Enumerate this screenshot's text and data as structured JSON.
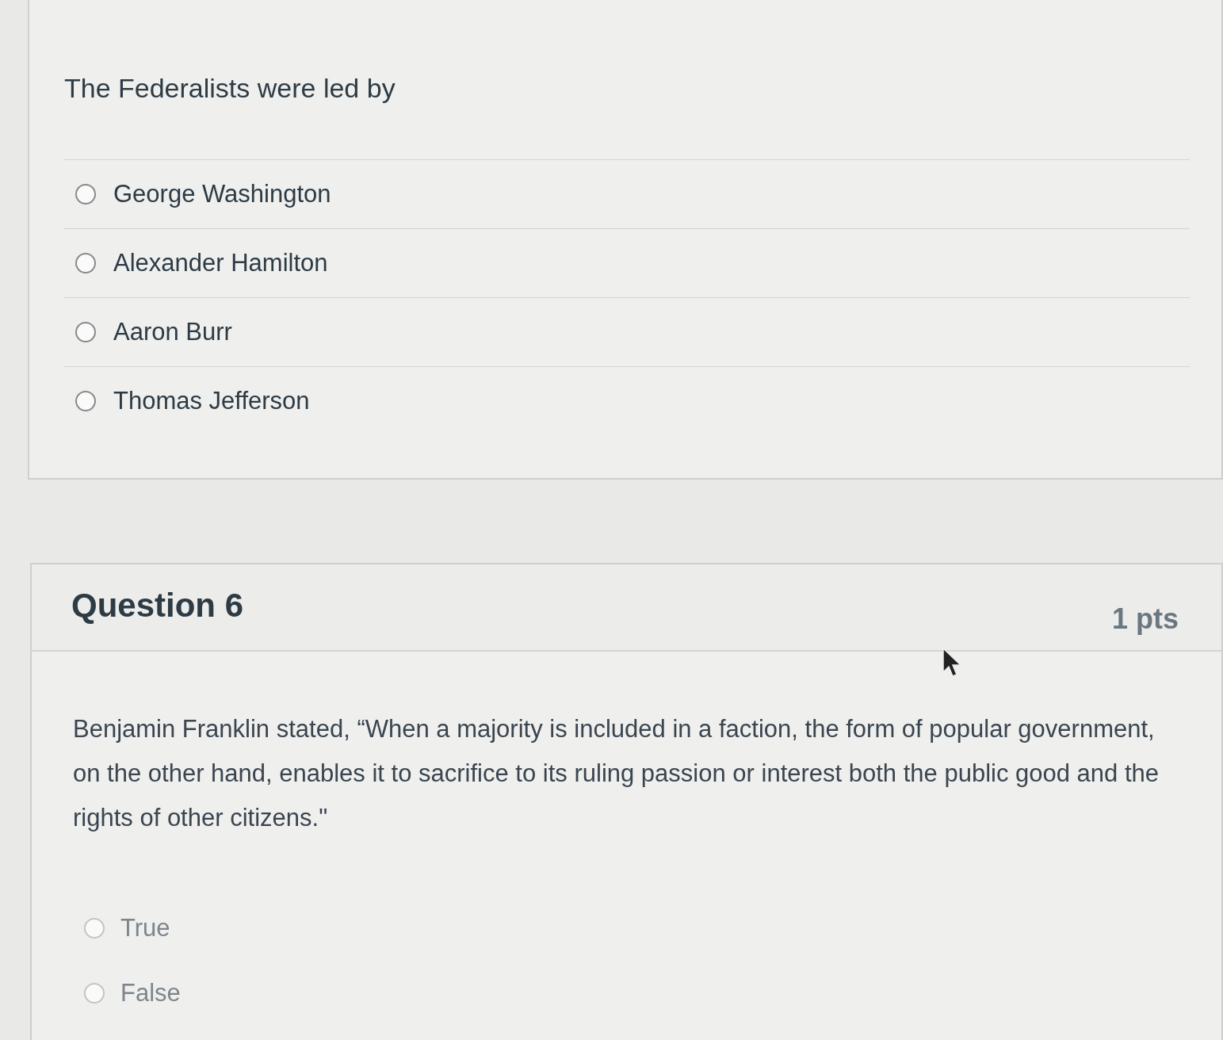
{
  "previous_question": {
    "text": "The Federalists were led by",
    "answers": [
      {
        "label": "George Washington",
        "selected": false
      },
      {
        "label": "Alexander Hamilton",
        "selected": false
      },
      {
        "label": "Aaron Burr",
        "selected": false
      },
      {
        "label": "Thomas Jefferson",
        "selected": false
      }
    ]
  },
  "question": {
    "title": "Question 6",
    "points": "1 pts",
    "text": "Benjamin Franklin stated, “When a majority is included in a faction, the form of popular government, on the other hand, enables it to sacrifice to its ruling passion or interest both the public good and the rights of other citizens.\"",
    "answers": [
      {
        "label": "True",
        "selected": false
      },
      {
        "label": "False",
        "selected": false
      }
    ]
  }
}
